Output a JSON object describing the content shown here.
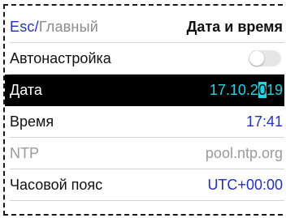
{
  "header": {
    "esc": "Esc",
    "separator": "/",
    "parent": "Главный",
    "title": "Дата и время"
  },
  "rows": {
    "autotune": {
      "label": "Автонастройка",
      "toggle_on": false
    },
    "date": {
      "label": "Дата",
      "value_before": "17.10.2",
      "value_cursor": "0",
      "value_after": "19"
    },
    "time": {
      "label": "Время",
      "value": "17:41"
    },
    "ntp": {
      "label": "NTP",
      "value": "pool.ntp.org"
    },
    "timezone": {
      "label": "Часовой пояс",
      "value": "UTC+00:00"
    }
  },
  "colors": {
    "accent": "#1f2fd0",
    "highlight": "#18d6e6",
    "selected_bg": "#000000",
    "disabled": "#9a9a9a"
  }
}
